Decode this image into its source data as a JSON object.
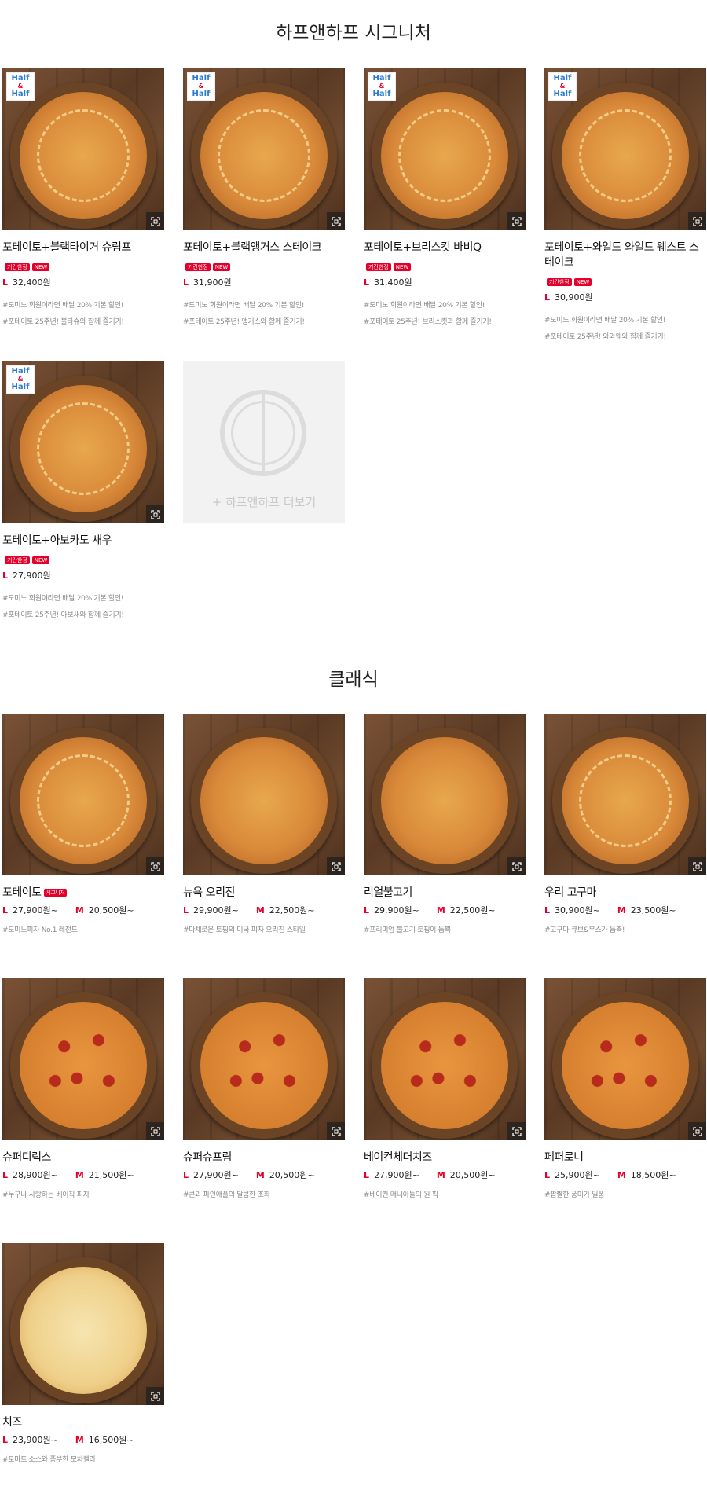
{
  "sections": [
    {
      "title": "하프앤하프 시그니처"
    },
    {
      "title": "클래식"
    }
  ],
  "half_half_badge": {
    "line1": "Half",
    "amp": "&",
    "line2": "Half"
  },
  "half_half_items": [
    {
      "name": "포테이토+블랙타이거 슈림프",
      "tags": [
        "기간한정",
        "NEW"
      ],
      "price_l": "32,400원",
      "desc1": "#도미노 회원이라면 배달 20% 기본 할인!",
      "desc2": "#포테이토 25주년! 블타슈와 함께 즐기기!"
    },
    {
      "name": "포테이토+블랙앵거스 스테이크",
      "tags": [
        "기간한정",
        "NEW"
      ],
      "price_l": "31,900원",
      "desc1": "#도미노 회원이라면 배달 20% 기본 할인!",
      "desc2": "#포테이토 25주년! 앵거스와 함께 즐기기!"
    },
    {
      "name": "포테이토+브리스킷 바비Q",
      "tags": [
        "기간한정",
        "NEW"
      ],
      "price_l": "31,400원",
      "desc1": "#도미노 회원이라면 배달 20% 기본 할인!",
      "desc2": "#포테이토 25주년! 브리스킷과 함께 즐기기!"
    },
    {
      "name": "포테이토+와일드 와일드 웨스트 스테이크",
      "tags": [
        "기간한정",
        "NEW"
      ],
      "price_l": "30,900원",
      "desc1": "#도미노 회원이라면 배달 20% 기본 할인!",
      "desc2": "#포테이토 25주년! 와와웨와 함께 즐기기!"
    },
    {
      "name": "포테이토+아보카도 새우",
      "tags": [
        "기간한정",
        "NEW"
      ],
      "price_l": "27,900원",
      "desc1": "#도미노 회원이라면 배달 20% 기본 할인!",
      "desc2": "#포테이토 25주년! 아보새와 함께 즐기기!"
    }
  ],
  "more_tile": {
    "label": "+ 하프앤하프 더보기"
  },
  "size_labels": {
    "l": "L",
    "m": "M"
  },
  "classic_items": [
    {
      "name": "포테이토",
      "tag": "시그니처",
      "price_l": "27,900원~",
      "price_m": "20,500원~",
      "desc": "#도미노피자 No.1 레전드",
      "style": "drizzle"
    },
    {
      "name": "뉴욕 오리진",
      "tag": "",
      "price_l": "29,900원~",
      "price_m": "22,500원~",
      "desc": "#다채로운 토핑의 미국 피자 오리진 스타일",
      "style": ""
    },
    {
      "name": "리얼불고기",
      "tag": "",
      "price_l": "29,900원~",
      "price_m": "22,500원~",
      "desc": "#프리미엄 불고기 토핑이 듬뿍",
      "style": ""
    },
    {
      "name": "우리 고구마",
      "tag": "",
      "price_l": "30,900원~",
      "price_m": "23,500원~",
      "desc": "#고구마 큐브&무스가 듬뿍!",
      "style": "drizzle"
    },
    {
      "name": "슈퍼디럭스",
      "tag": "",
      "price_l": "28,900원~",
      "price_m": "21,500원~",
      "desc": "#누구나 사랑하는 베이직 피자",
      "style": "pepperoni"
    },
    {
      "name": "슈퍼슈프림",
      "tag": "",
      "price_l": "27,900원~",
      "price_m": "20,500원~",
      "desc": "#콘과 파인애플의 달콤한 조화",
      "style": "pepperoni"
    },
    {
      "name": "베이컨체더치즈",
      "tag": "",
      "price_l": "27,900원~",
      "price_m": "20,500원~",
      "desc": "#베이컨 매니아들의 원 픽",
      "style": "pepperoni"
    },
    {
      "name": "페퍼로니",
      "tag": "",
      "price_l": "25,900원~",
      "price_m": "18,500원~",
      "desc": "#짭짤한 풍미가 일품",
      "style": "pepperoni"
    },
    {
      "name": "치즈",
      "tag": "",
      "price_l": "23,900원~",
      "price_m": "16,500원~",
      "desc": "#토마토 소스와 풍부한 모차렐라",
      "style": "cheese"
    }
  ]
}
